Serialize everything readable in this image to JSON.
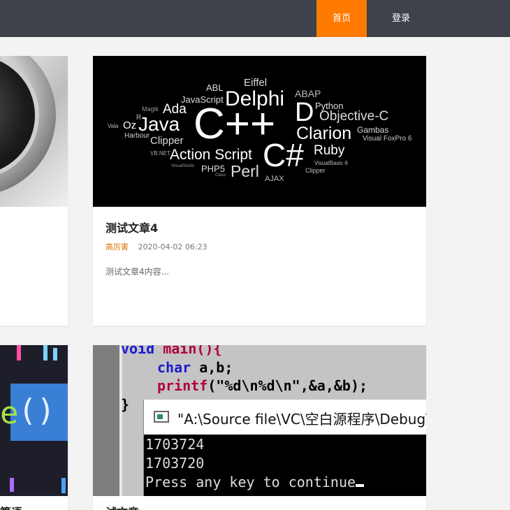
{
  "nav": {
    "home_label": "首页",
    "login_label": "登录"
  },
  "colors": {
    "topbar": "#3e434b",
    "accent": "#ff7a00",
    "author": "#e07000"
  },
  "articles": [
    {
      "title": "测试文章4",
      "author": "高厉害",
      "date": "2020-04-02 06:23",
      "excerpt": "测试文章4内容..."
    }
  ],
  "left_partial": {
    "title_fragment": "算语"
  },
  "bottom_partial": {
    "title_fragment": "试文章"
  },
  "wordcloud": {
    "words": [
      "ABL",
      "Eiffel",
      "Delphi",
      "ABAP",
      "JavaScript",
      "D",
      "Python",
      "Ada",
      "Magik",
      "Objective-C",
      "R",
      "C++",
      "Oz",
      "Java",
      "Clarion",
      "Gambas",
      "Vala",
      "Harbour",
      "Clipper",
      "Visual FoxPro 6",
      "Action Script",
      "C#",
      "Ruby",
      "VB.NET",
      "PHP5",
      "Perl",
      "VisualBasic 6",
      "VisualStudio",
      "Class",
      "AJAX",
      "Clipper"
    ]
  },
  "code": {
    "line1_kw": "void",
    "line1_rest": " main(){",
    "line2_kw": "char",
    "line2_rest": " a,b;",
    "line3_kw": "printf",
    "line3_rest": "(\"%d\\n%d\\n\",&a,&b);",
    "line4": "}",
    "console_title": "\"A:\\Source file\\VC\\空白源程序\\Debug\\",
    "out1": "1703724",
    "out2": "1703720",
    "out3": "Press any key to continue"
  }
}
